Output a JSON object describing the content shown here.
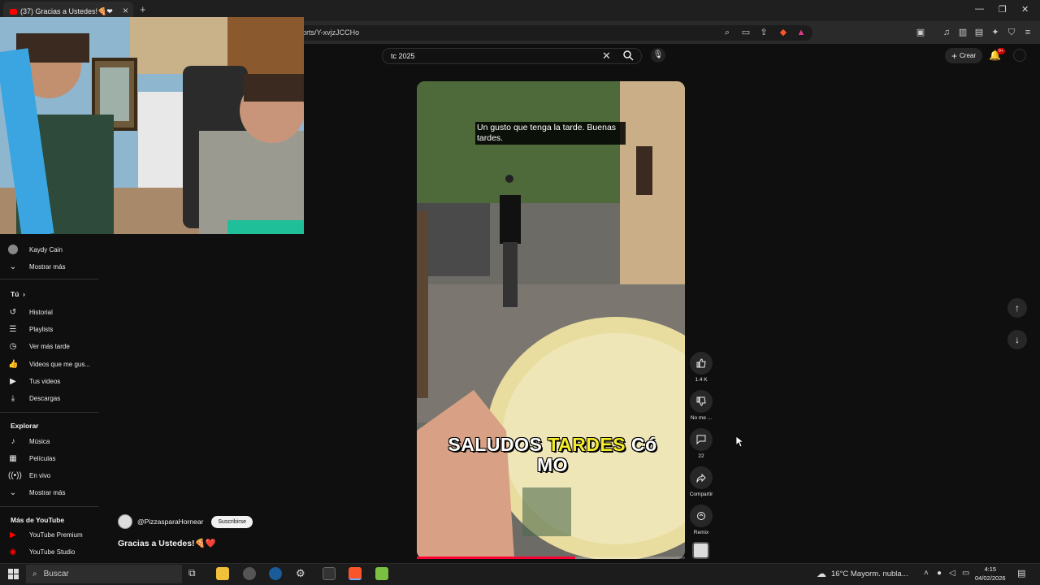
{
  "browser": {
    "tab_title": "(37) Gracias a Ustedes!🍕❤",
    "url": "orts/Y-xvjzJCCHo",
    "new_tab": "+",
    "tab_close": "×"
  },
  "header": {
    "search_value": "tc 2025",
    "create_label": "Crear",
    "notif_badge": "9+"
  },
  "sidebar": {
    "subscriptions": [
      {
        "label": "Kaydy Cain",
        "icon": "avatar"
      }
    ],
    "show_more_1": "Mostrar más",
    "you_heading": "Tú",
    "you_items": [
      {
        "label": "Historial",
        "icon": "history-icon"
      },
      {
        "label": "Playlists",
        "icon": "playlist-icon"
      },
      {
        "label": "Ver más tarde",
        "icon": "clock-icon"
      },
      {
        "label": "Videos que me gus...",
        "icon": "thumb-up-icon"
      },
      {
        "label": "Tus videos",
        "icon": "video-icon"
      },
      {
        "label": "Descargas",
        "icon": "download-icon"
      }
    ],
    "explore_heading": "Explorar",
    "explore_items": [
      {
        "label": "Música",
        "icon": "music-icon"
      },
      {
        "label": "Películas",
        "icon": "film-icon"
      },
      {
        "label": "En vivo",
        "icon": "live-icon"
      }
    ],
    "show_more_2": "Mostrar más",
    "more_heading": "Más de YouTube",
    "more_items": [
      {
        "label": "YouTube Premium",
        "icon": "youtube-premium-icon"
      },
      {
        "label": "YouTube Studio",
        "icon": "youtube-studio-icon"
      }
    ]
  },
  "short": {
    "caption_top": "Un gusto que tenga la tarde. Buenas tardes.",
    "caption_big_1": "SALUDOS",
    "caption_big_hl": "TARDES",
    "caption_big_2": "Có",
    "caption_big_3": "MO",
    "progress": 0.59
  },
  "actions": {
    "like_count": "1.4 K",
    "dislike_label": "No me ...",
    "comments_count": "22",
    "share_label": "Compartir",
    "remix_label": "Remix"
  },
  "channel": {
    "handle": "@PizzasparaHornear",
    "subscribe_label": "Suscribirse",
    "video_title": "Gracias a Ustedes!🍕❤️"
  },
  "taskbar": {
    "search_placeholder": "Buscar",
    "weather": "16°C  Mayorm. nubla...",
    "time": "4:15",
    "date": "04/02/2026"
  }
}
